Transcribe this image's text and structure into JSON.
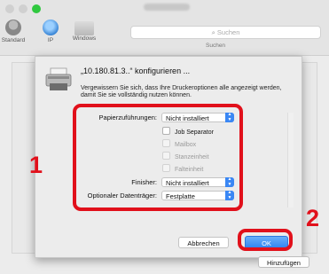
{
  "toolbar": {
    "tabs": [
      {
        "label": "Standard",
        "icon": "standard-printer-icon"
      },
      {
        "label": "IP",
        "icon": "ip-globe-icon"
      },
      {
        "label": "Windows",
        "icon": "windows-printer-icon"
      }
    ],
    "search_placeholder": "Suchen",
    "search_caption": "Suchen"
  },
  "dialog": {
    "title": "„10.180.81.3..“ konfigurieren ...",
    "description": "Vergewissern Sie sich, dass Ihre Druckeroptionen alle angezeigt werden, damit Sie sie vollständig nutzen können.",
    "options": {
      "paper_feed_label": "Papierzuführungen:",
      "paper_feed_value": "Nicht installiert",
      "checkboxes": [
        {
          "label": "Job Separator",
          "enabled": true
        },
        {
          "label": "Mailbox",
          "enabled": false
        },
        {
          "label": "Stanzeinheit",
          "enabled": false
        },
        {
          "label": "Falteinheit",
          "enabled": false
        }
      ],
      "finisher_label": "Finisher:",
      "finisher_value": "Nicht installiert",
      "storage_label": "Optionaler Datenträger:",
      "storage_value": "Festplatte"
    },
    "cancel_label": "Abbrechen",
    "ok_label": "OK"
  },
  "add_button_label": "Hinzufügen",
  "annotations": {
    "step1": "1",
    "step2": "2",
    "color": "#e1101b"
  },
  "colors": {
    "accent": "#2f83f1",
    "window_bg": "#ececec"
  }
}
